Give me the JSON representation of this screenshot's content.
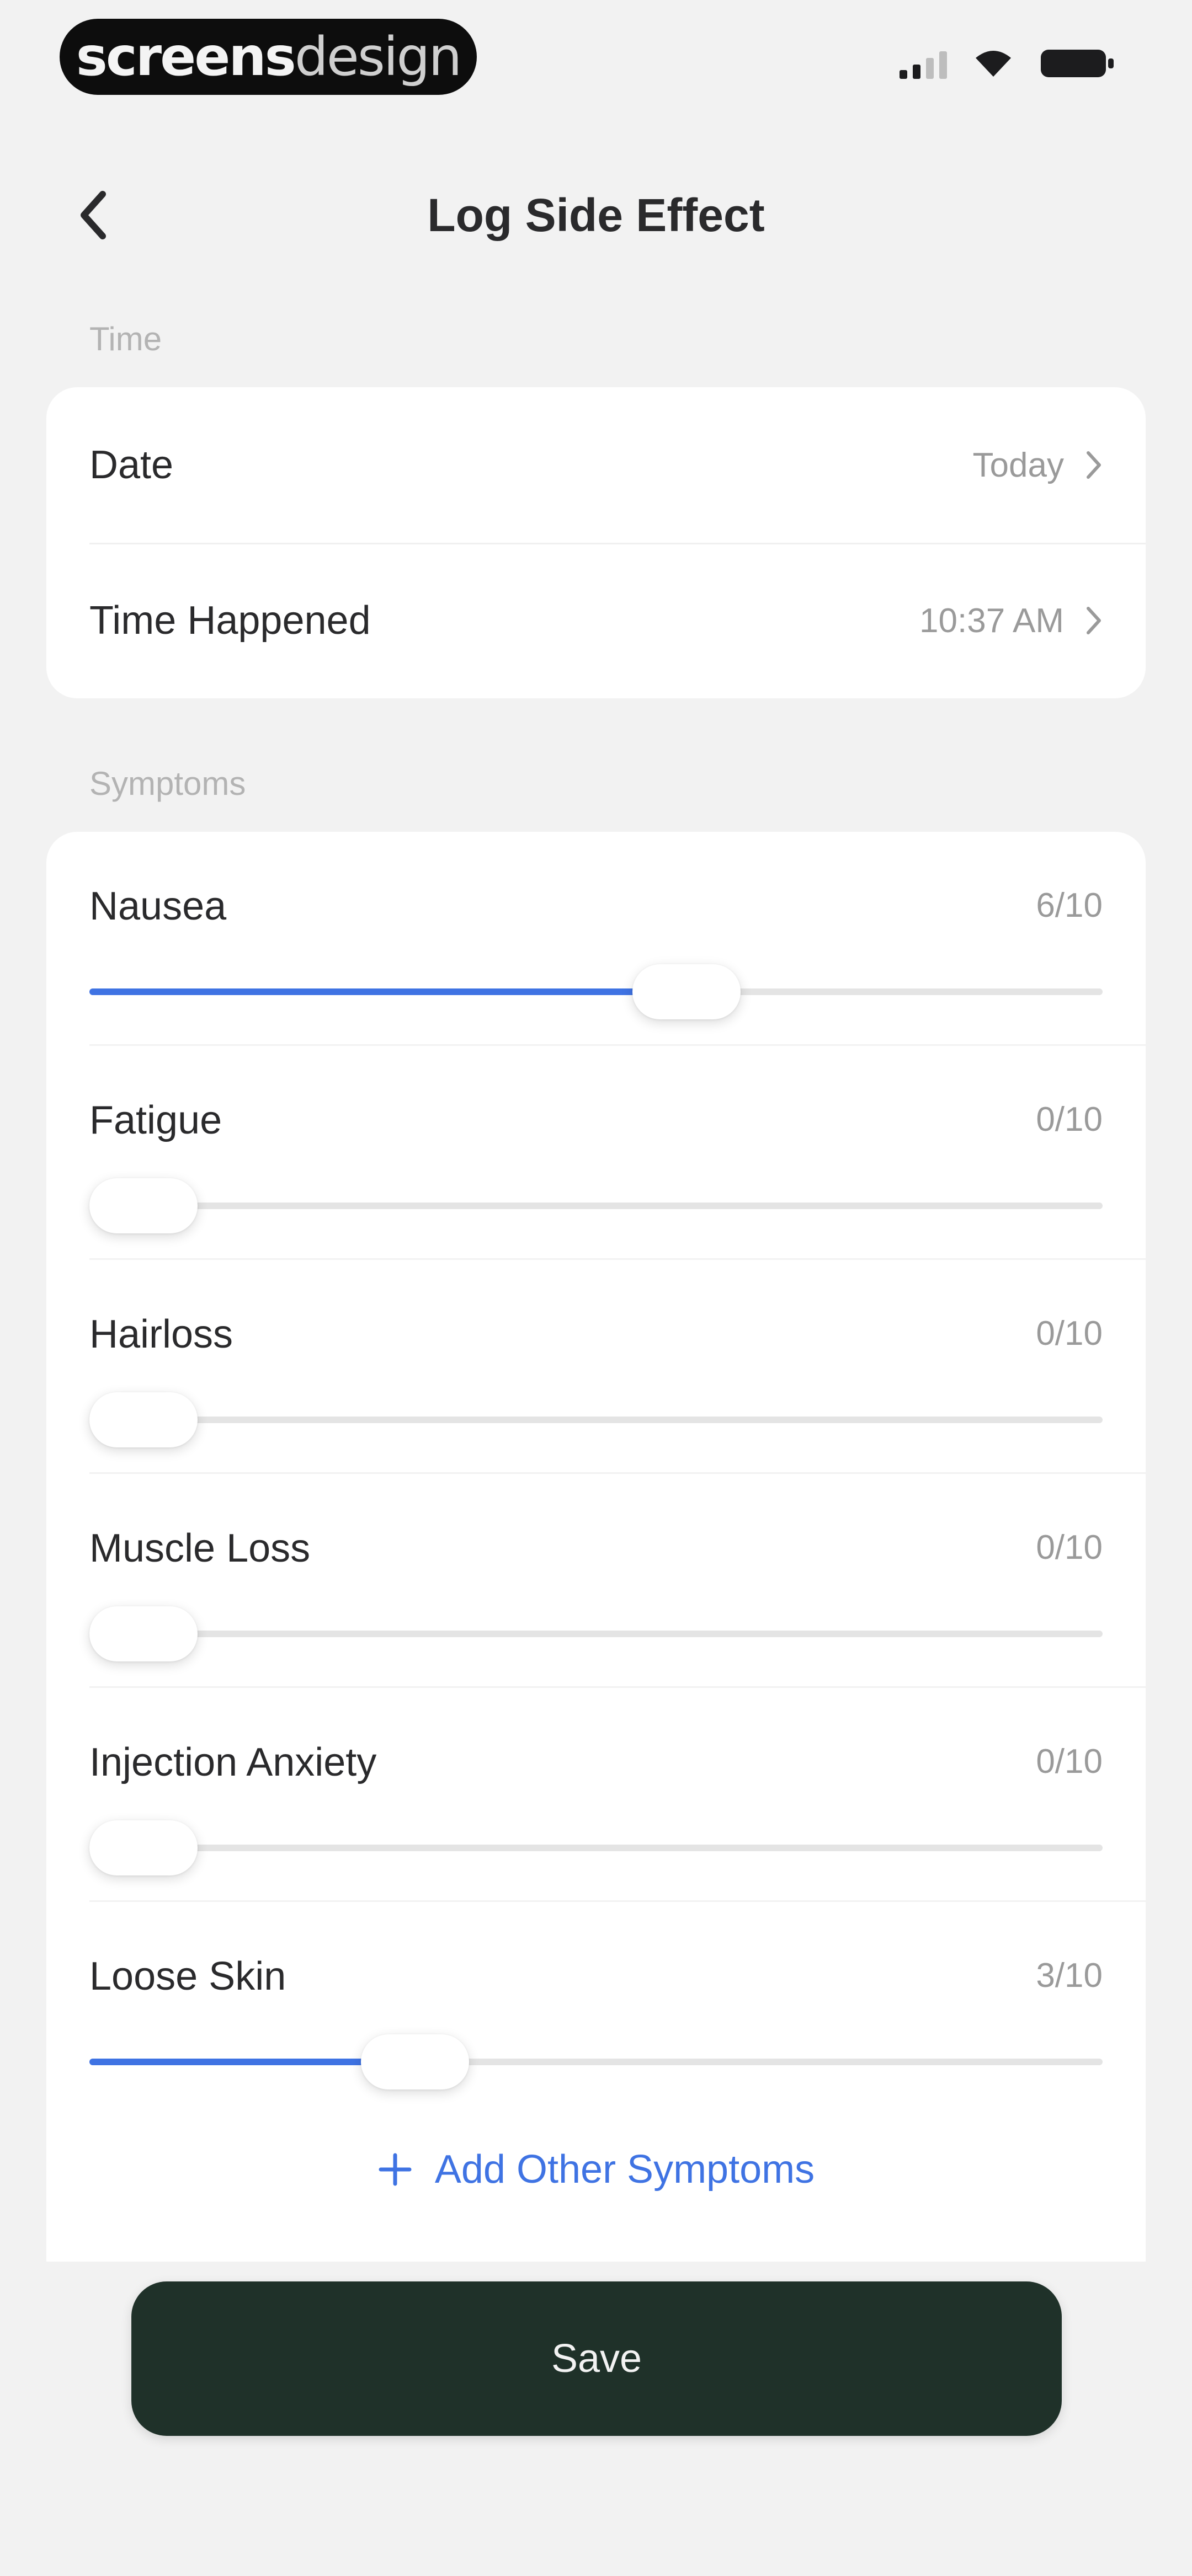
{
  "status_bar": {
    "brand_bold": "screens",
    "brand_light": "design"
  },
  "nav": {
    "title": "Log Side Effect"
  },
  "time_section": {
    "label": "Time",
    "rows": [
      {
        "label": "Date",
        "value": "Today"
      },
      {
        "label": "Time Happened",
        "value": "10:37 AM"
      }
    ]
  },
  "symptoms_section": {
    "label": "Symptoms",
    "items": [
      {
        "name": "Nausea",
        "score_text": "6/10",
        "level": 0.6
      },
      {
        "name": "Fatigue",
        "score_text": "0/10",
        "level": 0
      },
      {
        "name": "Hairloss",
        "score_text": "0/10",
        "level": 0
      },
      {
        "name": "Muscle Loss",
        "score_text": "0/10",
        "level": 0
      },
      {
        "name": "Injection Anxiety",
        "score_text": "0/10",
        "level": 0
      },
      {
        "name": "Loose Skin",
        "score_text": "3/10",
        "level": 0.3
      }
    ],
    "add_label": "Add Other Symptoms"
  },
  "actions": {
    "save_label": "Save"
  },
  "colors": {
    "accent": "#3f73e3",
    "save_bg": "#1f3129",
    "background": "#f2f2f2"
  },
  "icons": {
    "back": "chevron-left-icon",
    "row": "chevron-right-icon",
    "add": "plus-icon"
  }
}
